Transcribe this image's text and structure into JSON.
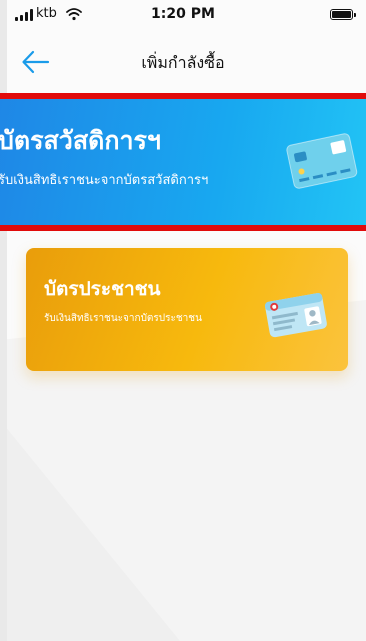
{
  "status_bar": {
    "carrier": "ktb",
    "time": "1:20 PM"
  },
  "nav": {
    "title": "เพิ่มกำลังซื้อ"
  },
  "cards": {
    "welfare": {
      "title": "บัตรสวัสดิการฯ",
      "subtitle": "รับเงินสิทธิเราชนะจากบัตรสวัสดิการฯ",
      "color": "#1a9be9",
      "border_color": "#e10b0b"
    },
    "id_card": {
      "title": "บัตรประชาชน",
      "subtitle": "รับเงินสิทธิเราชนะจากบัตรประชาชน",
      "color": "#f4b10c"
    }
  },
  "icons": {
    "back": "arrow-left-icon",
    "welfare_card": "credit-card-icon",
    "id_card": "id-card-icon"
  },
  "accent_color": "#1a9be9"
}
